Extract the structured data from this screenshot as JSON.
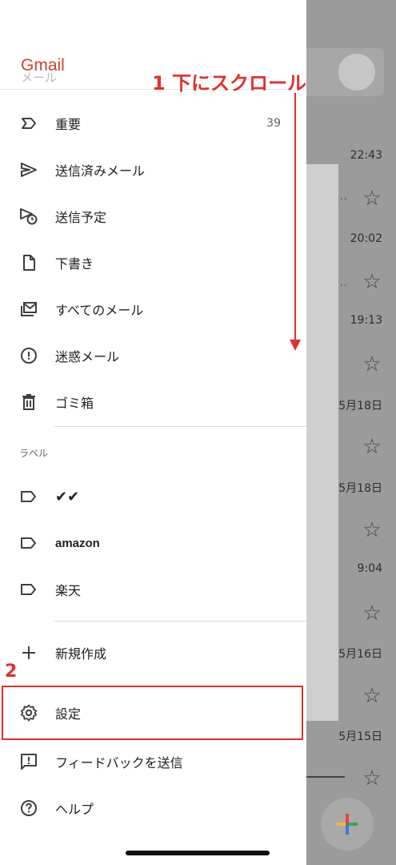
{
  "background": {
    "times": [
      "22:43",
      "20:02",
      "19:13",
      "5月18日",
      "5月18日",
      "9:04",
      "5月16日",
      "5月15日"
    ]
  },
  "drawer": {
    "brand": "Gmail",
    "brand_sub": "メール",
    "items": [
      {
        "label": "重要",
        "count": "39",
        "icon": "label-important-icon"
      },
      {
        "label": "送信済みメール",
        "icon": "send-icon"
      },
      {
        "label": "送信予定",
        "icon": "scheduled-send-icon"
      },
      {
        "label": "下書き",
        "icon": "draft-icon"
      },
      {
        "label": "すべてのメール",
        "icon": "all-mail-icon"
      },
      {
        "label": "迷惑メール",
        "icon": "spam-icon"
      },
      {
        "label": "ゴミ箱",
        "icon": "trash-icon"
      }
    ],
    "labels_section": "ラベル",
    "labels": [
      {
        "label": "✔✔",
        "icon": "label-icon"
      },
      {
        "label": "amazon",
        "icon": "label-icon"
      },
      {
        "label": "楽天",
        "icon": "label-icon"
      }
    ],
    "create_new": "新規作成",
    "settings": "設定",
    "feedback": "フィードバックを送信",
    "help": "ヘルプ"
  },
  "annotations": {
    "step1": "1 下にスクロール",
    "step2": "2"
  },
  "colors": {
    "accent": "#e03030",
    "gmail_red": "#d23f31"
  }
}
